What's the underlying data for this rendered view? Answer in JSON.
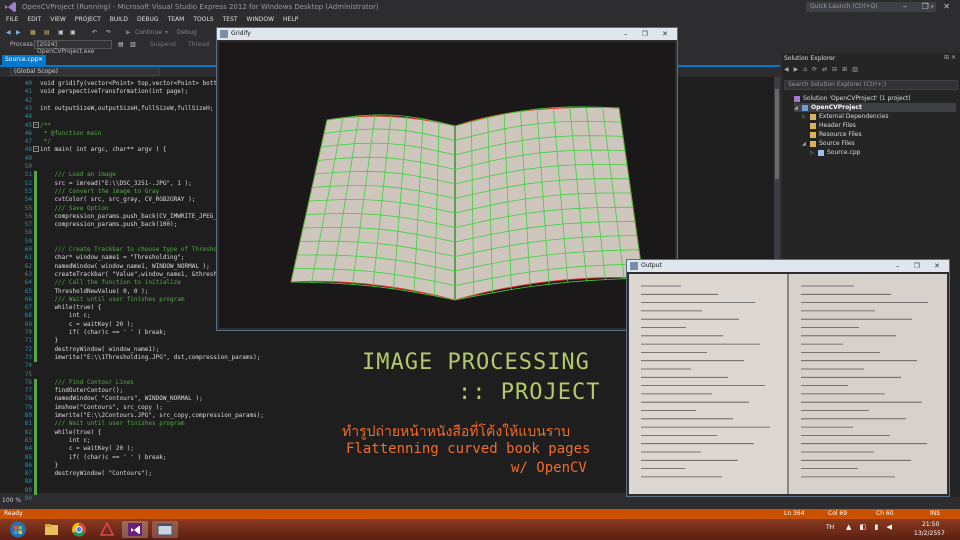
{
  "window": {
    "title": "OpenCVProject (Running) - Microsoft Visual Studio Express 2012 for Windows Desktop (Administrator)",
    "quick_launch_placeholder": "Quick Launch (Ctrl+Q)",
    "controls": "– ❐ ✕"
  },
  "menu": [
    "FILE",
    "EDIT",
    "VIEW",
    "PROJECT",
    "BUILD",
    "DEBUG",
    "TEAM",
    "TOOLS",
    "TEST",
    "WINDOW",
    "HELP"
  ],
  "toolbar": {
    "continue_label": "Continue",
    "debug_label": "Debug",
    "process_label": "Process:",
    "process_value": "[2024] OpenCVProject.exe",
    "suspend_label": "Suspend",
    "thread_label": "Thread:"
  },
  "editor": {
    "tab_label": "Source.cpp",
    "scope": "(Global Scope)",
    "zoom": "100 %",
    "lines": [
      {
        "n": "40",
        "t": "void gridify(vector<Point> top,vector<Point> bottom);",
        "c": ""
      },
      {
        "n": "41",
        "t": "void perspectiveTransformation(int page);",
        "c": ""
      },
      {
        "n": "42",
        "t": "",
        "c": ""
      },
      {
        "n": "43",
        "t": "int outputSizeW,outputSizeH,fullSizeW,fullSizeH;",
        "c": ""
      },
      {
        "n": "44",
        "t": "",
        "c": ""
      },
      {
        "n": "45",
        "t": "/**",
        "c": "cm"
      },
      {
        "n": "46",
        "t": " * @function main",
        "c": "cm"
      },
      {
        "n": "47",
        "t": " */",
        "c": "cm"
      },
      {
        "n": "48",
        "t": "int main( int argc, char** argv ) {",
        "c": ""
      },
      {
        "n": "49",
        "t": "",
        "c": ""
      },
      {
        "n": "50",
        "t": "",
        "c": ""
      },
      {
        "n": "51",
        "t": "    /// Load an image",
        "c": "cm"
      },
      {
        "n": "52",
        "t": "    src = imread(\"E:\\\\DSC_3251-.JPG\", 1 );",
        "c": ""
      },
      {
        "n": "53",
        "t": "    /// Convert the image to Gray",
        "c": "cm"
      },
      {
        "n": "54",
        "t": "    cvtColor( src, src_gray, CV_RGB2GRAY );",
        "c": ""
      },
      {
        "n": "55",
        "t": "    /// Save Option",
        "c": "cm"
      },
      {
        "n": "56",
        "t": "    compression_params.push_back(CV_IMWRITE_JPEG_QUALITY);",
        "c": ""
      },
      {
        "n": "57",
        "t": "    compression_params.push_back(100);",
        "c": ""
      },
      {
        "n": "58",
        "t": "",
        "c": ""
      },
      {
        "n": "59",
        "t": "",
        "c": ""
      },
      {
        "n": "60",
        "t": "    /// Create Trackbar to choose type of Threshold",
        "c": "cm"
      },
      {
        "n": "61",
        "t": "    char* window_name1 = \"Thresholding\";",
        "c": ""
      },
      {
        "n": "62",
        "t": "    namedWindow( window_name1, WINDOW_NORMAL );",
        "c": ""
      },
      {
        "n": "63",
        "t": "    createTrackbar( \"Value\",window_name1, &threshold_value, 255 );",
        "c": ""
      },
      {
        "n": "64",
        "t": "    /// Call the function to initialize",
        "c": "cm"
      },
      {
        "n": "65",
        "t": "    ThresholdNewValue( 0, 0 );",
        "c": ""
      },
      {
        "n": "66",
        "t": "    /// Wait until user finishes program",
        "c": "cm"
      },
      {
        "n": "67",
        "t": "    while(true) {",
        "c": ""
      },
      {
        "n": "68",
        "t": "        int c;",
        "c": ""
      },
      {
        "n": "69",
        "t": "        c = waitKey( 20 );",
        "c": ""
      },
      {
        "n": "70",
        "t": "        if( (char)c == ' ' ) break;",
        "c": ""
      },
      {
        "n": "71",
        "t": "    }",
        "c": ""
      },
      {
        "n": "72",
        "t": "    destroyWindow( window_name1);",
        "c": ""
      },
      {
        "n": "73",
        "t": "    imwrite(\"E:\\\\1Thresholding.JPG\", dst,compression_params);",
        "c": ""
      },
      {
        "n": "74",
        "t": "",
        "c": ""
      },
      {
        "n": "75",
        "t": "",
        "c": ""
      },
      {
        "n": "76",
        "t": "    /// Find Contour Lines",
        "c": "cm"
      },
      {
        "n": "77",
        "t": "    findOuterContour();",
        "c": ""
      },
      {
        "n": "78",
        "t": "    namedWindow( \"Contours\", WINDOW_NORMAL );",
        "c": ""
      },
      {
        "n": "79",
        "t": "    imshow(\"Contours\", src_copy );",
        "c": ""
      },
      {
        "n": "80",
        "t": "    imwrite(\"E:\\\\2Contours.JPG\", src_copy,compression_params);",
        "c": ""
      },
      {
        "n": "81",
        "t": "    /// Wait until user finishes program",
        "c": "cm"
      },
      {
        "n": "82",
        "t": "    while(true) {",
        "c": ""
      },
      {
        "n": "83",
        "t": "        int c;",
        "c": ""
      },
      {
        "n": "84",
        "t": "        c = waitKey( 20 );",
        "c": ""
      },
      {
        "n": "85",
        "t": "        if( (char)c == ' ' ) break;",
        "c": ""
      },
      {
        "n": "86",
        "t": "    }",
        "c": ""
      },
      {
        "n": "87",
        "t": "    destroyWindow( \"Contours\");",
        "c": ""
      },
      {
        "n": "88",
        "t": "",
        "c": ""
      },
      {
        "n": "89",
        "t": "",
        "c": ""
      },
      {
        "n": "90",
        "t": "    detectDistance();",
        "c": ""
      }
    ]
  },
  "solution_explorer": {
    "title": "Solution Explorer",
    "search_placeholder": "Search Solution Explorer (Ctrl+;)",
    "items": [
      {
        "label": "Solution 'OpenCVProject' (1 project)",
        "indent": 0,
        "arrow": ""
      },
      {
        "label": "OpenCVProject",
        "indent": 1,
        "arrow": "◢"
      },
      {
        "label": "External Dependencies",
        "indent": 2,
        "arrow": "▷"
      },
      {
        "label": "Header Files",
        "indent": 2,
        "arrow": ""
      },
      {
        "label": "Resource Files",
        "indent": 2,
        "arrow": ""
      },
      {
        "label": "Source Files",
        "indent": 2,
        "arrow": "◢"
      },
      {
        "label": "Source.cpp",
        "indent": 3,
        "arrow": "▷"
      }
    ]
  },
  "gridify_window": {
    "title": "Gridify"
  },
  "output_window": {
    "title": "Output"
  },
  "overlay": {
    "line1": "IMAGE PROCESSING",
    "line2": ":: PROJECT",
    "thai": "ทำรูปถ่ายหน้าหนังสือที่โค้งให้แบนราบ",
    "line3": "Flattenning curved book pages",
    "line4": "w/ OpenCV"
  },
  "status": {
    "ready": "Ready",
    "ln": "Ln 364",
    "col": "Col 69",
    "ch": "Ch 60",
    "ins": "INS"
  },
  "taskbar": {
    "lang": "TH",
    "time": "21:50",
    "date": "13/2/2557"
  },
  "colors": {
    "accent": "#007acc",
    "status": "#ca5100",
    "overlay_green": "#b6c86b",
    "overlay_orange": "#f06c2b",
    "grid_green": "#3fcf3f",
    "grid_red": "#e0302a"
  }
}
